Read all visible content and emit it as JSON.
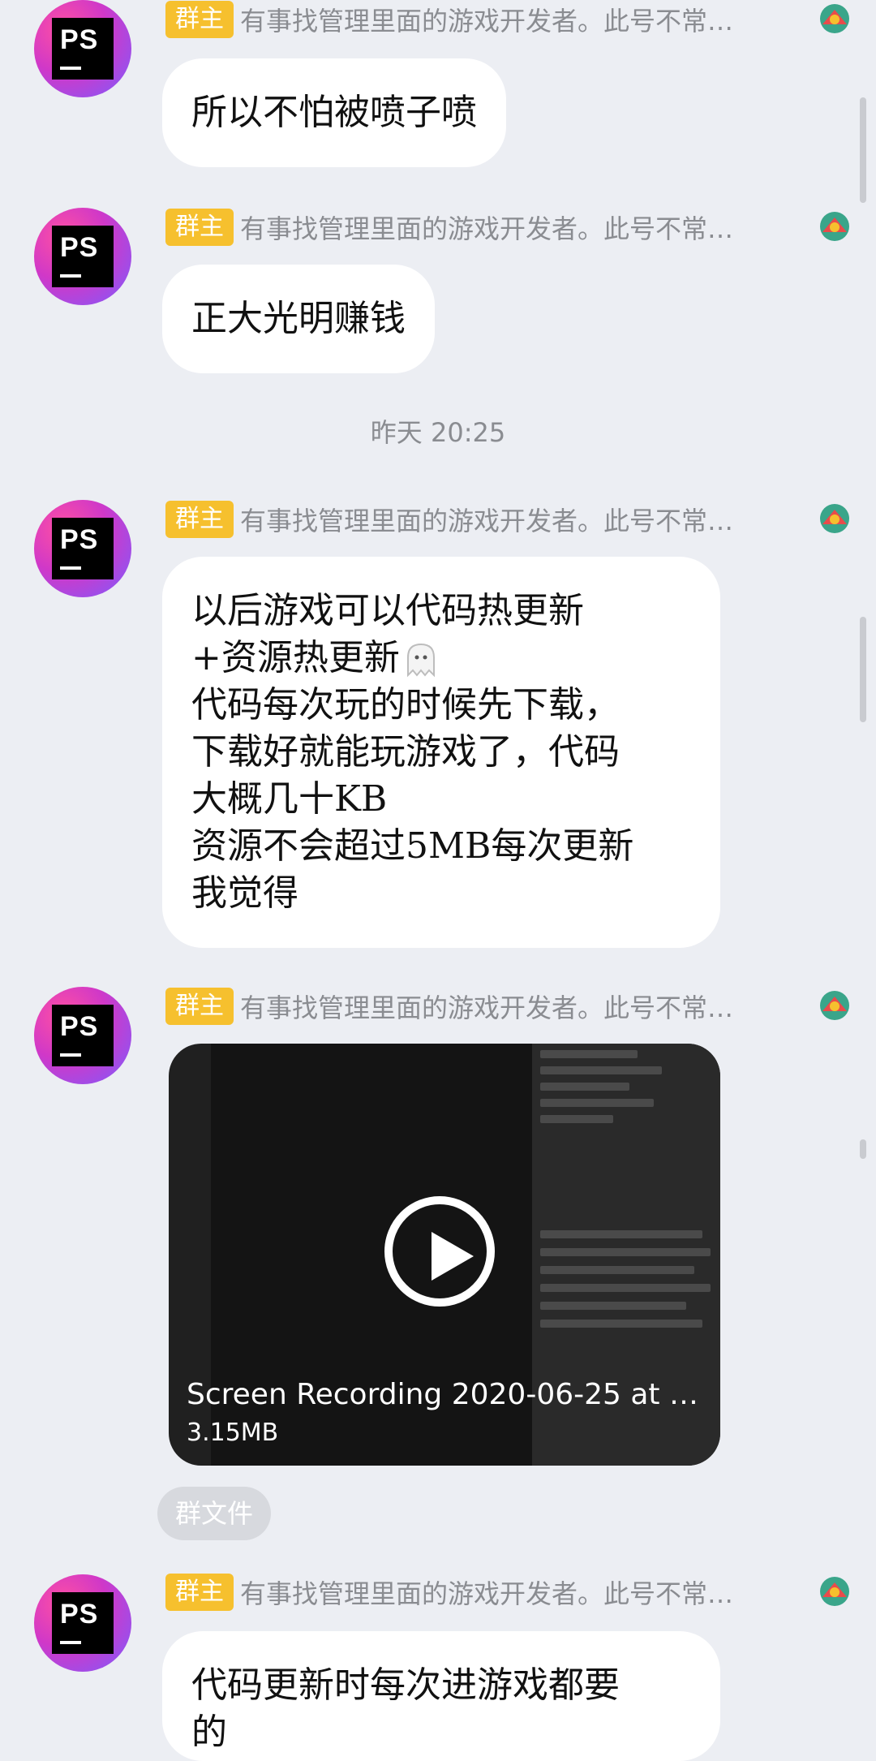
{
  "messages": [
    {
      "badge": "群主",
      "nick": "有事找管理里面的游戏开发者。此号不常…",
      "lines": [
        "所以不怕被喷子喷"
      ]
    },
    {
      "badge": "群主",
      "nick": "有事找管理里面的游戏开发者。此号不常…",
      "lines": [
        "正大光明赚钱"
      ]
    },
    {
      "badge": "群主",
      "nick": "有事找管理里面的游戏开发者。此号不常…",
      "lines": [
        "以后游戏可以代码热更新",
        "+资源热更新",
        "代码每次玩的时候先下载，",
        "下载好就能玩游戏了，代码",
        "大概几十KB",
        "资源不会超过5MB每次更新",
        "我觉得"
      ]
    },
    {
      "badge": "群主",
      "nick": "有事找管理里面的游戏开发者。此号不常…",
      "video": {
        "title": "Screen Recording 2020-06-25 at 1…",
        "size": "3.15MB"
      },
      "tag": "群文件"
    },
    {
      "badge": "群主",
      "nick": "有事找管理里面的游戏开发者。此号不常…",
      "lines": [
        "代码更新时每次进游戏都要",
        "的"
      ]
    }
  ],
  "timestamp": "昨天 20:25",
  "icons": {
    "avatar": "photoshop-logo-avatar",
    "emoji": "ghost-emoji",
    "deco": "dragon-badge-icon",
    "play": "play-icon"
  }
}
